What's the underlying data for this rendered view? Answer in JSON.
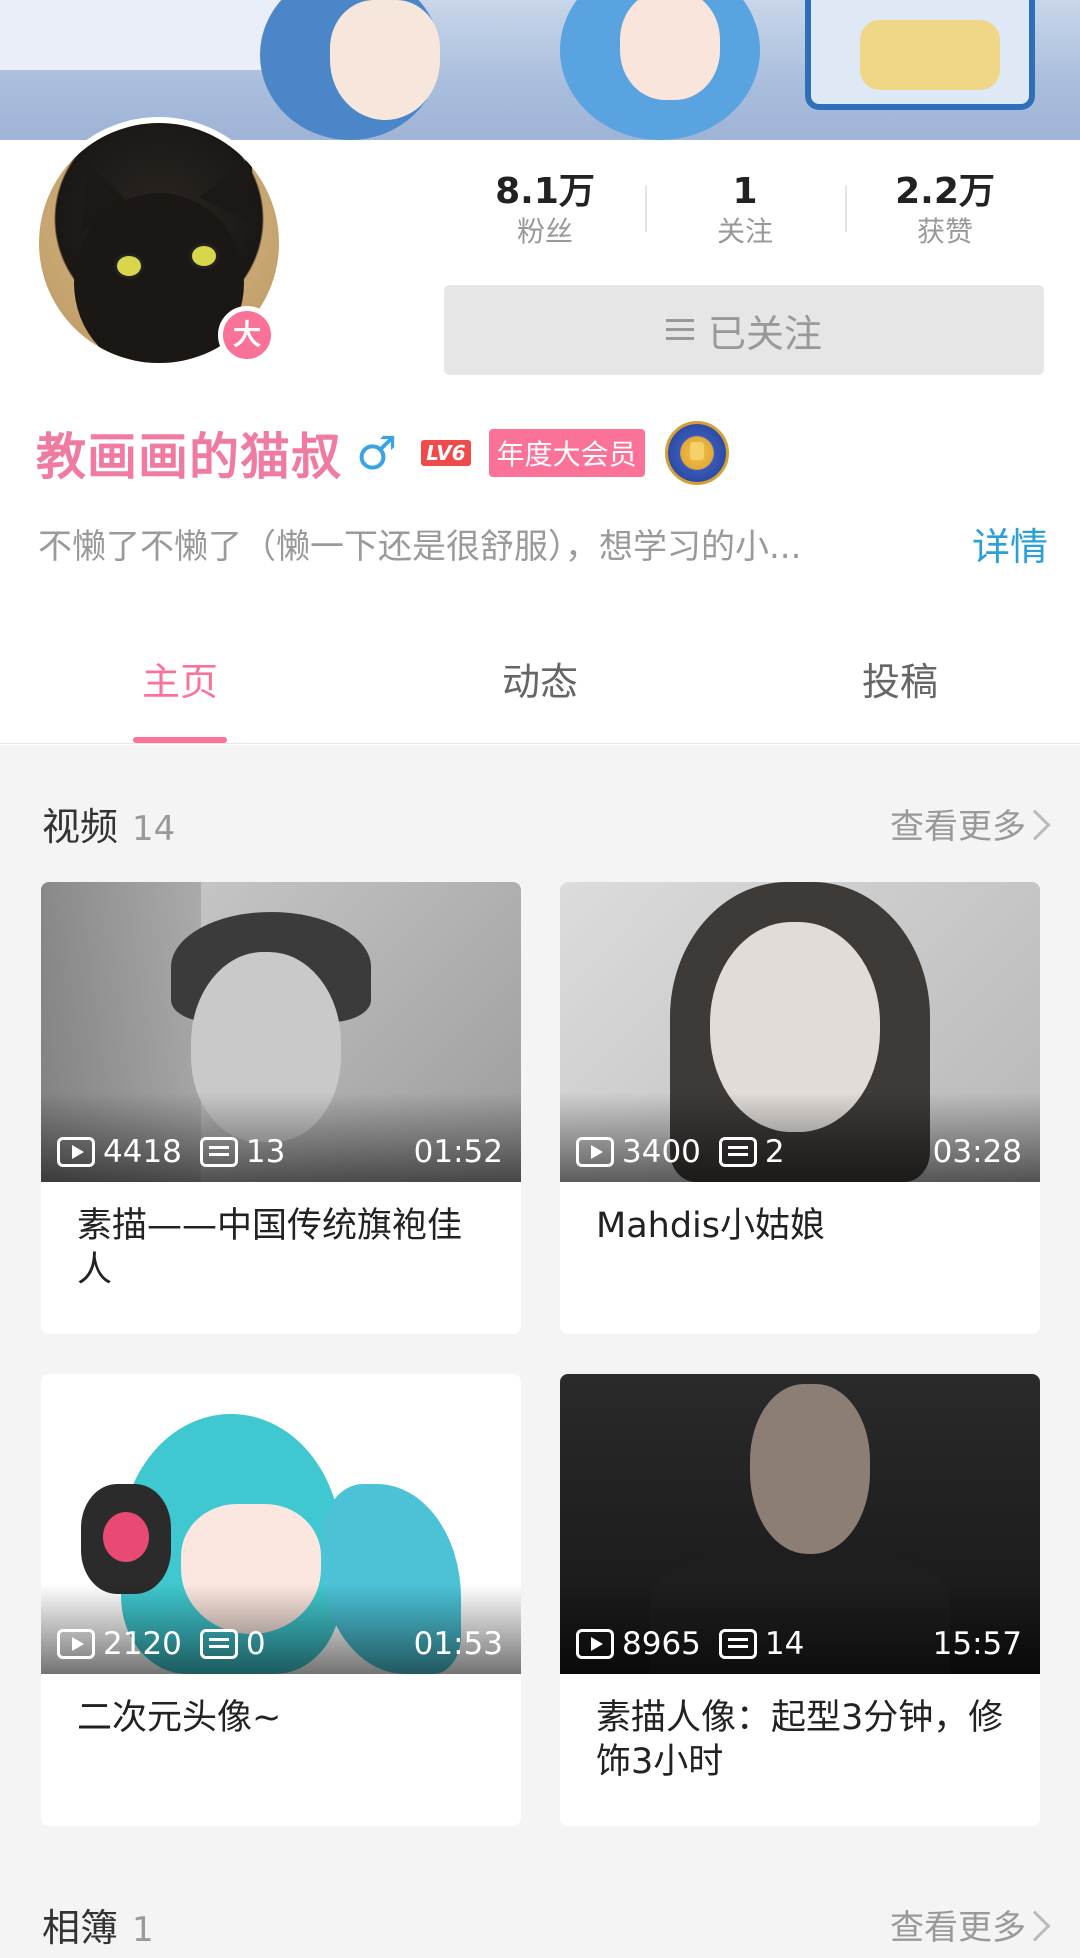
{
  "profile": {
    "avatar_badge": "大",
    "stats": [
      {
        "value": "8.1万",
        "label": "粉丝"
      },
      {
        "value": "1",
        "label": "关注"
      },
      {
        "value": "2.2万",
        "label": "获赞"
      }
    ],
    "follow_button": "已关注",
    "name": "教画画的猫叔",
    "gender_symbol": "♂",
    "level": "LV6",
    "vip_label": "年度大会员",
    "bio": "不懒了不懒了（懒一下还是很舒服），想学习的小...",
    "detail_link": "详情"
  },
  "tabs": [
    {
      "label": "主页",
      "active": true
    },
    {
      "label": "动态",
      "active": false
    },
    {
      "label": "投稿",
      "active": false
    }
  ],
  "videos_section": {
    "title": "视频",
    "count": "14",
    "see_more": "查看更多"
  },
  "videos": [
    {
      "plays": "4418",
      "danmaku": "13",
      "duration": "01:52",
      "title": "素描——中国传统旗袍佳人"
    },
    {
      "plays": "3400",
      "danmaku": "2",
      "duration": "03:28",
      "title": "Mahdis小姑娘"
    },
    {
      "plays": "2120",
      "danmaku": "0",
      "duration": "01:53",
      "title": "二次元头像~"
    },
    {
      "plays": "8965",
      "danmaku": "14",
      "duration": "15:57",
      "title": "素描人像：起型3分钟，修饰3小时"
    }
  ],
  "album_section": {
    "title": "相簿",
    "count": "1",
    "see_more": "查看更多"
  },
  "colors": {
    "accent_pink": "#fb7299",
    "name_pink": "#f07ba0",
    "link_blue": "#2aa0d6",
    "gender_blue": "#3aa3e3"
  }
}
